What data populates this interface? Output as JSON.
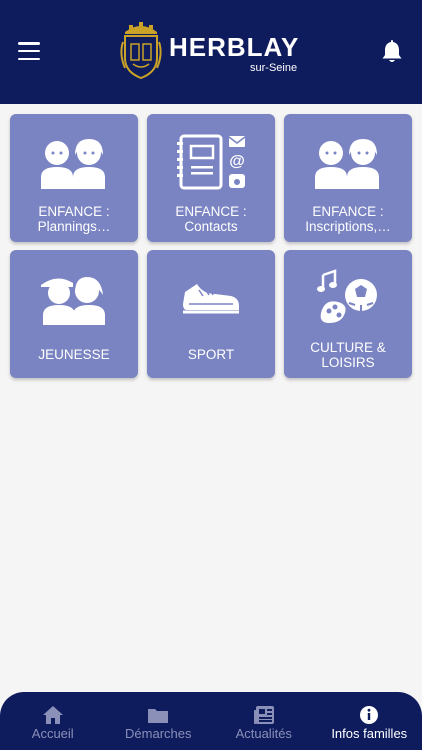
{
  "header": {
    "title": "HERBLAY",
    "subtitle": "sur-Seine",
    "colors": {
      "background": "#0e1b5c",
      "crest_gold": "#c9a227"
    }
  },
  "tiles": [
    {
      "line1": "ENFANCE :",
      "line2": "Plannings…",
      "icon": "children-icon"
    },
    {
      "line1": "ENFANCE :",
      "line2": "Contacts",
      "icon": "contact-book-icon"
    },
    {
      "line1": "ENFANCE :",
      "line2": "Inscriptions,…",
      "icon": "children-icon"
    },
    {
      "line1": "JEUNESSE",
      "line2": "",
      "icon": "youth-icon"
    },
    {
      "line1": "SPORT",
      "line2": "",
      "icon": "sneaker-icon"
    },
    {
      "line1": "CULTURE &",
      "line2": "LOISIRS",
      "icon": "culture-icon"
    }
  ],
  "tile_color": "#7b84c2",
  "tabbar": {
    "items": [
      {
        "label": "Accueil",
        "icon": "home-icon",
        "active": false
      },
      {
        "label": "Démarches",
        "icon": "folder-icon",
        "active": false
      },
      {
        "label": "Actualités",
        "icon": "newspaper-icon",
        "active": false
      },
      {
        "label": "Infos familles",
        "icon": "info-icon",
        "active": true
      }
    ]
  }
}
